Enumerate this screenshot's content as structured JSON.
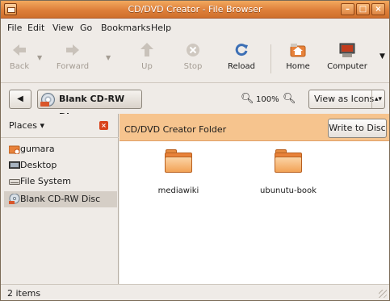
{
  "window": {
    "title": "CD/DVD Creator - File Browser"
  },
  "menubar": {
    "items": [
      "File",
      "Edit",
      "View",
      "Go",
      "Bookmarks",
      "Help"
    ]
  },
  "toolbar": {
    "back": "Back",
    "forward": "Forward",
    "up": "Up",
    "stop": "Stop",
    "reload": "Reload",
    "home": "Home",
    "computer": "Computer"
  },
  "location": {
    "path_button": "Blank CD-RW Disc",
    "zoom": "100%",
    "view_mode": "View as Icons"
  },
  "sidebar": {
    "title": "Places",
    "items": [
      {
        "label": "gumara",
        "icon": "home-folder-icon"
      },
      {
        "label": "Desktop",
        "icon": "desktop-icon"
      },
      {
        "label": "File System",
        "icon": "drive-icon"
      },
      {
        "label": "Blank CD-RW Disc",
        "icon": "disc-icon",
        "active": true
      }
    ]
  },
  "main": {
    "strip_title": "CD/DVD Creator Folder",
    "write_button": "Write to Disc",
    "files": [
      {
        "name": "mediawiki",
        "icon": "folder-icon"
      },
      {
        "name": "ubunutu-book",
        "icon": "folder-icon"
      }
    ]
  },
  "status": {
    "text": "2 items"
  },
  "colors": {
    "titlebar": "#de7f3a",
    "strip": "#f6c48e",
    "folder": "#e8823a"
  }
}
